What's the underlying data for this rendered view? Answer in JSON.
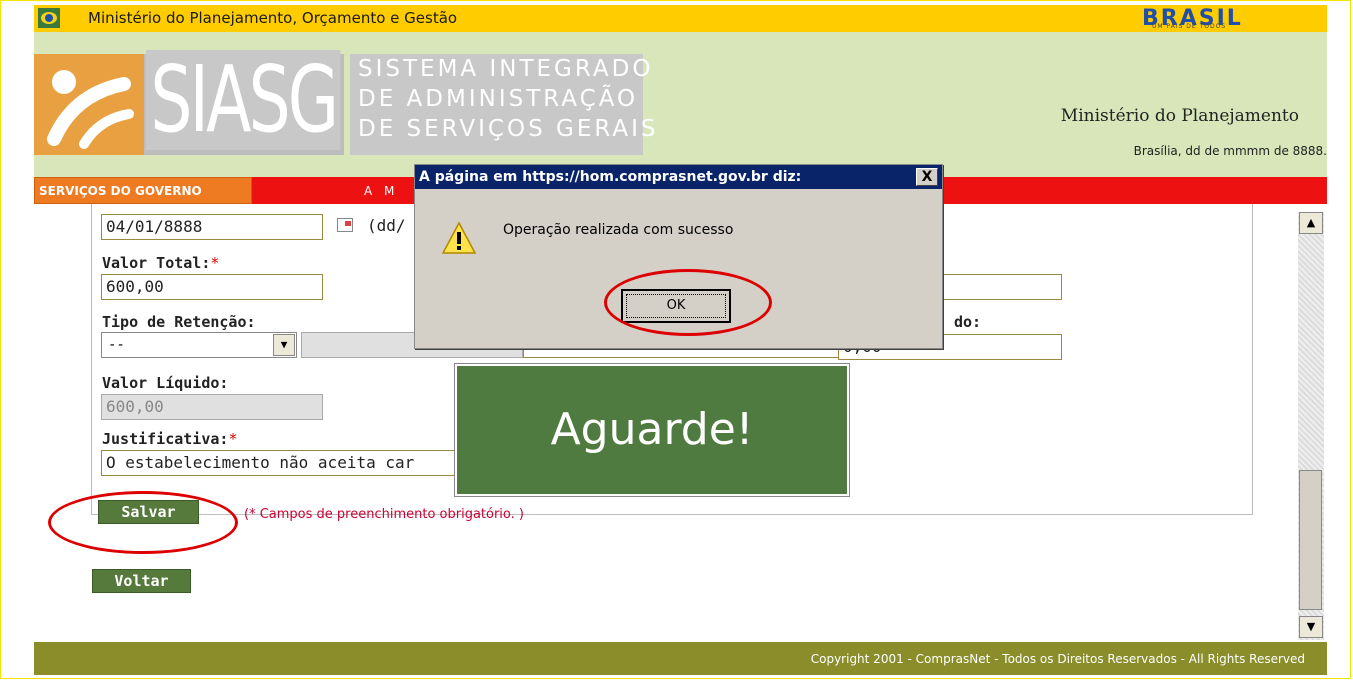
{
  "topbar": {
    "title": "Ministério do Planejamento, Orçamento e Gestão",
    "brasil_logo_text": "BRASIL",
    "brasil_logo_sub": "UM PAÍS DE TODOS"
  },
  "header": {
    "siasg": "SIASG",
    "sistema_line1": "SISTEMA INTEGRADO",
    "sistema_line2": "DE ADMINISTRAÇÃO",
    "sistema_line3": "DE SERVIÇOS GERAIS",
    "ministerio": "Ministério do Planejamento",
    "date": "Brasília, dd de mmmm de 8888."
  },
  "navbar": {
    "servicos": "SERVIÇOS DO GOVERNO",
    "text": "A M"
  },
  "form": {
    "date_value": "04/01/8888",
    "date_hint": "(dd/",
    "valor_total_label": "Valor Total:",
    "valor_total_value": "600,00",
    "tipo_retencao_label": "Tipo de Retenção:",
    "tipo_retencao_value": "--",
    "right_label_partial": "do:",
    "right_value_partial": "0,00",
    "valor_liquido_label": "Valor Líquido:",
    "valor_liquido_value": "600,00",
    "justificativa_label": "Justificativa:",
    "justificativa_value": "O estabelecimento não aceita car",
    "required_mark": "*",
    "salvar": "Salvar",
    "obrigatorio": "(* Campos de preenchimento obrigatório. )",
    "voltar": "Voltar"
  },
  "overlay": {
    "aguarde": "Aguarde!"
  },
  "dialog": {
    "title": "A página em https://hom.comprasnet.gov.br diz:",
    "close": "X",
    "message": "Operação realizada com sucesso",
    "ok": "OK"
  },
  "footer": {
    "copyright": "Copyright 2001 - ComprasNet - Todos os Direitos Reservados - All Rights Reserved"
  },
  "colors": {
    "topbar": "#ffcc00",
    "header": "#d8e6ba",
    "navbar": "#ee1111",
    "button_green": "#557a3c",
    "footer": "#8a8d2a",
    "annotation_red": "#dd0000"
  }
}
